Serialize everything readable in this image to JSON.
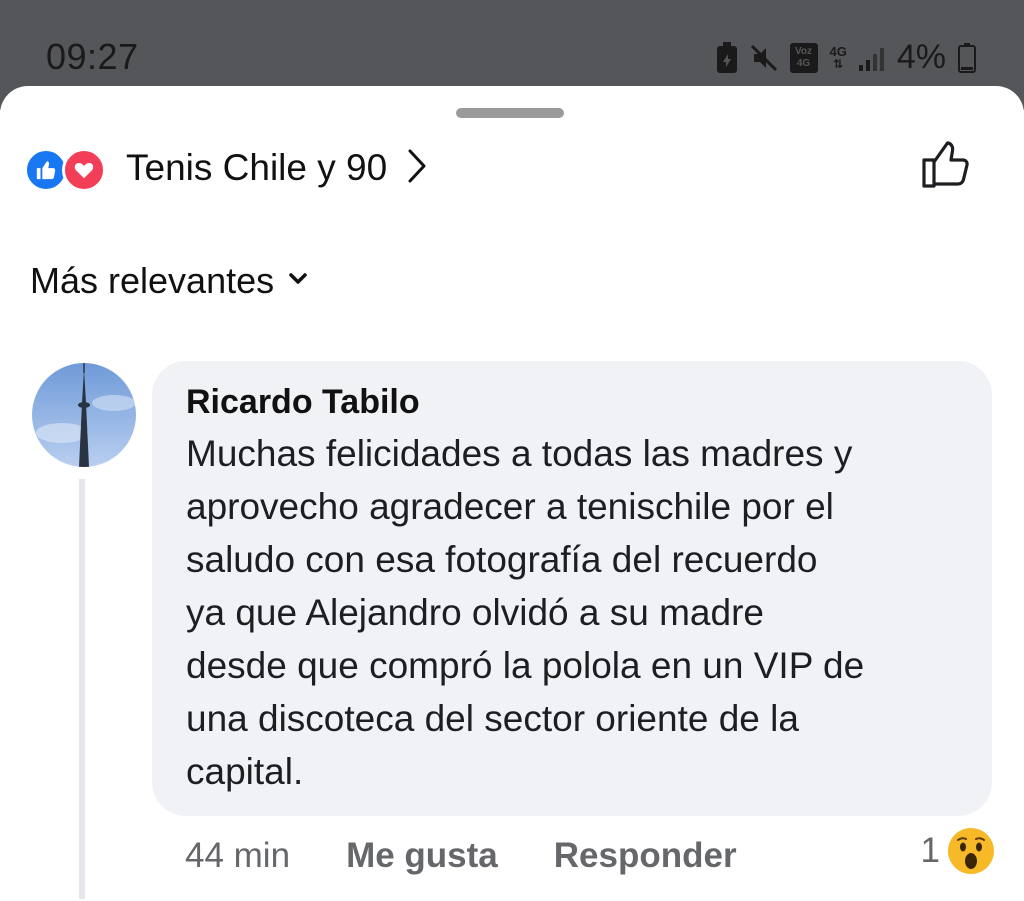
{
  "status_bar": {
    "time": "09:27",
    "network_voz_top": "Voz",
    "network_voz_bottom": "4G",
    "network_4g": "4G",
    "battery_percent": "4%",
    "icons": [
      "battery-saver-icon",
      "mute-icon",
      "volte-icon",
      "data-4g-icon",
      "signal-icon",
      "battery-icon"
    ]
  },
  "header": {
    "reactions_label": "Tenis Chile y 90",
    "reaction_types": [
      "like-reaction-icon",
      "love-reaction-icon"
    ],
    "like_color": "#1877f2",
    "love_color": "#f33e58"
  },
  "sort": {
    "label": "Más relevantes"
  },
  "comment": {
    "author": "Ricardo Tabilo",
    "text": "Muchas felicidades a todas las madres y aprovecho agradecer a tenischile por el saludo con esa fotografía del recuerdo ya que Alejandro olvidó a su madre desde que compró la polola en un VIP de una discoteca del sector oriente de la capital.",
    "lines": [
      "Muchas felicidades a todas las madres y",
      "aprovecho agradecer a tenischile por el",
      "saludo con esa fotografía del recuerdo",
      "ya que Alejandro olvidó a su madre",
      "desde que compró la polola en un VIP de",
      "una discoteca del sector oriente de la",
      "capital."
    ],
    "timestamp": "44 min",
    "like_label": "Me gusta",
    "reply_label": "Responder",
    "reaction_count": "1",
    "reaction_icon": "wow-reaction-icon"
  }
}
